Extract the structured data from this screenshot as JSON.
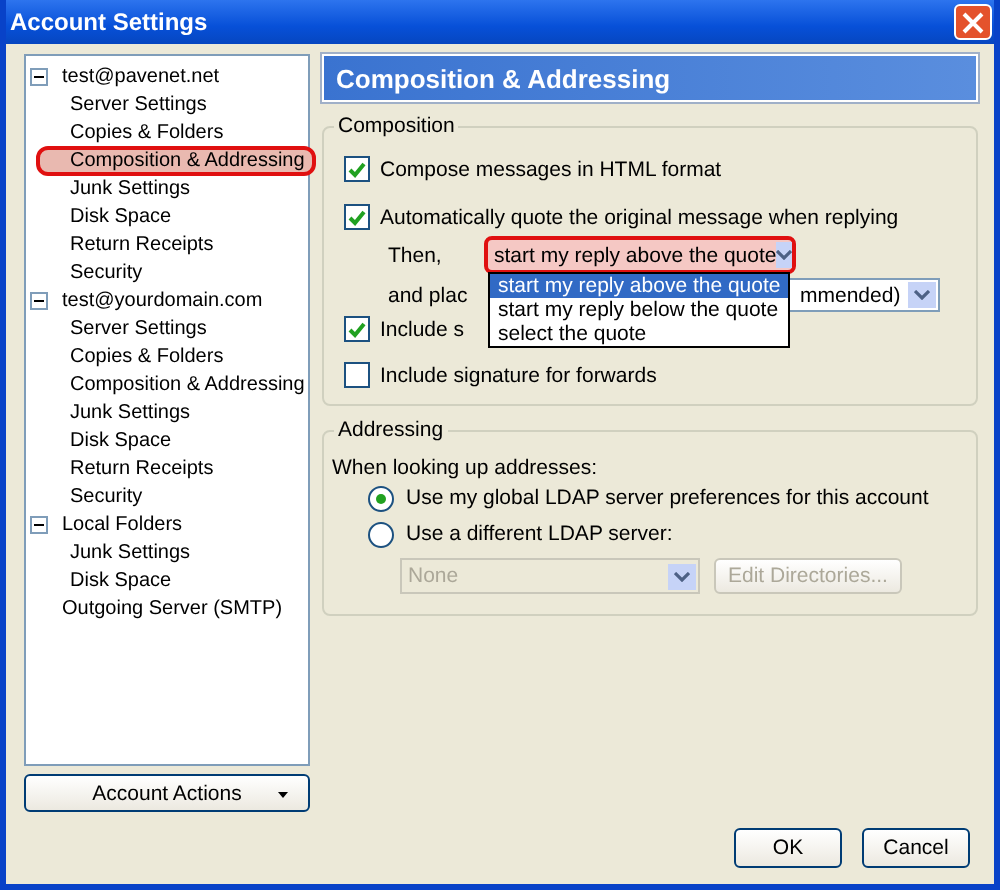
{
  "window": {
    "title": "Account Settings"
  },
  "tree": [
    {
      "label": "test@pavenet.net",
      "selected": false,
      "expanded": true,
      "children": [
        {
          "label": "Server Settings",
          "selected": false
        },
        {
          "label": "Copies & Folders",
          "selected": false
        },
        {
          "label": "Composition & Addressing",
          "selected": true
        },
        {
          "label": "Junk Settings",
          "selected": false
        },
        {
          "label": "Disk Space",
          "selected": false
        },
        {
          "label": "Return Receipts",
          "selected": false
        },
        {
          "label": "Security",
          "selected": false
        }
      ]
    },
    {
      "label": "test@yourdomain.com",
      "selected": false,
      "expanded": true,
      "children": [
        {
          "label": "Server Settings",
          "selected": false
        },
        {
          "label": "Copies & Folders",
          "selected": false
        },
        {
          "label": "Composition & Addressing",
          "selected": false
        },
        {
          "label": "Junk Settings",
          "selected": false
        },
        {
          "label": "Disk Space",
          "selected": false
        },
        {
          "label": "Return Receipts",
          "selected": false
        },
        {
          "label": "Security",
          "selected": false
        }
      ]
    },
    {
      "label": "Local Folders",
      "selected": false,
      "expanded": true,
      "children": [
        {
          "label": "Junk Settings",
          "selected": false
        },
        {
          "label": "Disk Space",
          "selected": false
        }
      ]
    },
    {
      "label": "Outgoing Server (SMTP)",
      "selected": false
    }
  ],
  "account_actions": "Account Actions",
  "header": "Composition & Addressing",
  "composition": {
    "legend": "Composition",
    "html": {
      "label": "Compose messages in HTML format",
      "checked": true
    },
    "quote": {
      "label": "Automatically quote the original message when replying",
      "checked": true
    },
    "then_label": "Then,",
    "then_value": "start my reply above the quote",
    "then_open": true,
    "then_options": [
      {
        "label": "start my reply above the quote",
        "selected": true
      },
      {
        "label": "start my reply below the quote",
        "selected": false
      },
      {
        "label": "select the quote",
        "selected": false
      }
    ],
    "place_label": "and plac",
    "place_value": "mmended)",
    "sig_reply": {
      "label": "Include s",
      "checked": true
    },
    "sig_forward": {
      "label": "Include signature for forwards",
      "checked": false
    }
  },
  "addressing": {
    "legend": "Addressing",
    "prompt": "When looking up addresses:",
    "options": [
      {
        "label": "Use my global LDAP server preferences for this account",
        "selected": true
      },
      {
        "label": "Use a different LDAP server:",
        "selected": false
      }
    ],
    "server_value": "None",
    "server_disabled": true,
    "edit_button": "Edit Directories...",
    "edit_disabled": true
  },
  "buttons": [
    "OK",
    "Cancel"
  ]
}
